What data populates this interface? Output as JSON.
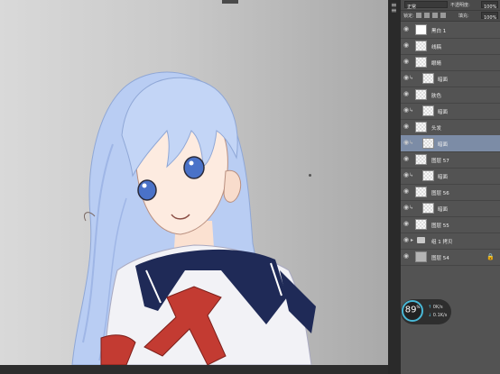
{
  "options_bar": {
    "blend_mode": "正常",
    "opacity_label": "不透明度:",
    "opacity_value": "100%",
    "lock_label": "锁定:",
    "fill_label": "填充:",
    "fill_value": "100%"
  },
  "layers": [
    {
      "name": "黑白 1",
      "type": "adjustment"
    },
    {
      "name": "线稿",
      "type": "normal"
    },
    {
      "name": "眼睛",
      "type": "normal"
    },
    {
      "name": "暗面",
      "type": "clipped"
    },
    {
      "name": "肤色",
      "type": "normal"
    },
    {
      "name": "暗面",
      "type": "clipped"
    },
    {
      "name": "头发",
      "type": "normal"
    },
    {
      "name": "暗面",
      "type": "clipped",
      "selected": true
    },
    {
      "name": "图层 57",
      "type": "normal"
    },
    {
      "name": "暗面",
      "type": "clipped"
    },
    {
      "name": "图层 56",
      "type": "normal"
    },
    {
      "name": "暗面",
      "type": "clipped"
    },
    {
      "name": "图层 55",
      "type": "normal"
    },
    {
      "name": "组 1 拷贝",
      "type": "group"
    },
    {
      "name": "图层 54",
      "type": "locked"
    }
  ],
  "perf_monitor": {
    "percent": "89",
    "percent_unit": "%",
    "upload": "0K/s",
    "download": "0.1K/s"
  },
  "colors": {
    "panel_bg": "#535353",
    "selected_layer": "#7c8ca6",
    "hair": "#b9cdf3",
    "eyes": "#4a72c8",
    "uniform_collar": "#1f2a57",
    "scarf": "#c33b32"
  }
}
